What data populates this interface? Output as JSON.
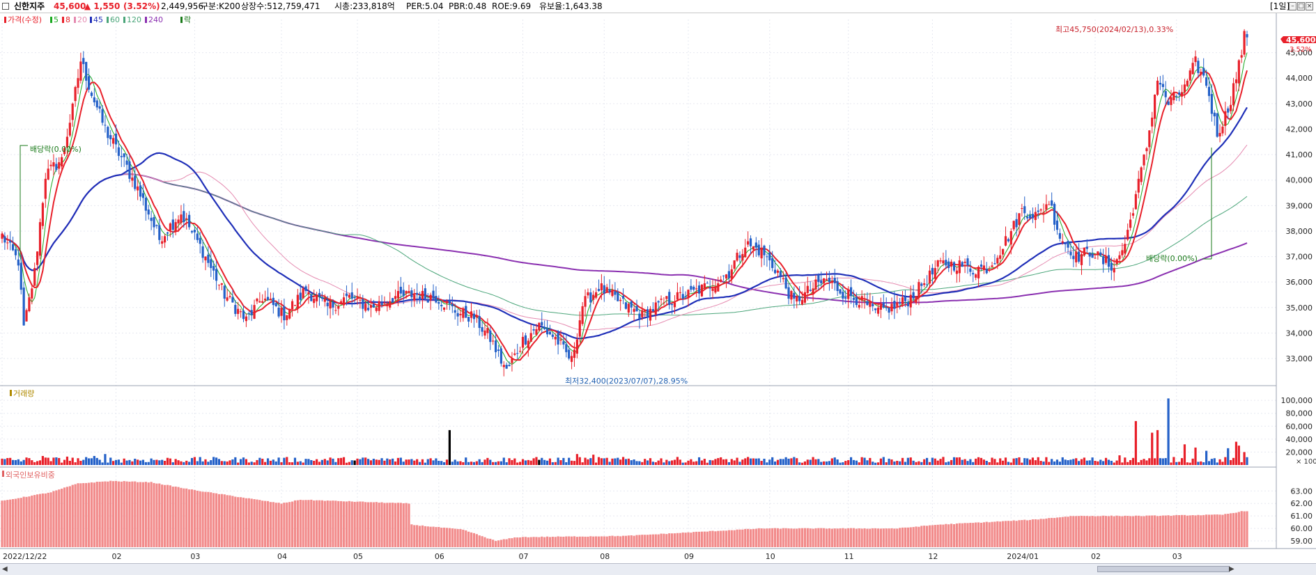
{
  "header": {
    "stock_name": "신한지주",
    "price": "45,600",
    "change": "▲ 1,550",
    "change_pct": "(3.52%)",
    "volume": "2,449,956",
    "market": "구분:K200",
    "shares": "상장수:512,759,471",
    "market_cap": "시총:233,818억",
    "per": "PER:5.04",
    "pbr": "PBR:0.48",
    "roe": "ROE:9.69",
    "float": "유보율:1,643.38",
    "period": "[1일]"
  },
  "colors": {
    "up": "#e8202a",
    "down": "#2360c8",
    "ma5": "#19a81f",
    "ma20": "#e8202a",
    "ma45": "#1f2fb8",
    "ma60": "#e58ab0",
    "ma120": "#4aa579",
    "ma240": "#8a2fb0",
    "ratio": "#f28b8b",
    "dividend": "#1a7a1a"
  },
  "legend": {
    "price": "가격(수정)",
    "ma5": "5",
    "ma8": "8",
    "ma20": "20",
    "ma45": "45",
    "ma60": "60",
    "ma120": "120",
    "ma240": "240",
    "dividend": "락"
  },
  "annotations": {
    "high": "최고45,750(2024/02/13),0.33%",
    "low": "최저32,400(2023/07/07),28.95%",
    "dividend_left": "배당락(0.00%)",
    "dividend_right": "배당락(0.00%)",
    "last_price": "45,600",
    "last_pct": "3.52%"
  },
  "chart_data": [
    {
      "type": "candlestick",
      "title": "",
      "x_labels": [
        "2022/12/22",
        "02",
        "03",
        "04",
        "05",
        "06",
        "07",
        "08",
        "09",
        "10",
        "11",
        "12",
        "2024/01",
        "02",
        "03"
      ],
      "y_ticks": [
        33000,
        34000,
        35000,
        36000,
        37000,
        38000,
        39000,
        40000,
        41000,
        42000,
        43000,
        44000,
        45000
      ],
      "y_tick_labels": [
        "33,000",
        "34,000",
        "35,000",
        "36,000",
        "37,000",
        "38,000",
        "39,000",
        "40,000",
        "41,000",
        "42,000",
        "43,000",
        "44,000",
        "45,000"
      ],
      "ylim": [
        32100,
        46300
      ],
      "close_anchors": [
        [
          0,
          37800
        ],
        [
          6,
          36800
        ],
        [
          8,
          34200
        ],
        [
          12,
          36400
        ],
        [
          16,
          40200
        ],
        [
          22,
          40800
        ],
        [
          26,
          42800
        ],
        [
          29,
          44700
        ],
        [
          33,
          43400
        ],
        [
          38,
          42000
        ],
        [
          45,
          40700
        ],
        [
          52,
          39200
        ],
        [
          58,
          37700
        ],
        [
          66,
          38700
        ],
        [
          74,
          37200
        ],
        [
          82,
          35500
        ],
        [
          90,
          34500
        ],
        [
          96,
          35400
        ],
        [
          104,
          34700
        ],
        [
          112,
          35700
        ],
        [
          120,
          35000
        ],
        [
          128,
          35400
        ],
        [
          136,
          35000
        ],
        [
          144,
          35400
        ],
        [
          152,
          35500
        ],
        [
          160,
          35400
        ],
        [
          168,
          34800
        ],
        [
          174,
          34600
        ],
        [
          180,
          33800
        ],
        [
          186,
          32500
        ],
        [
          192,
          33700
        ],
        [
          198,
          34300
        ],
        [
          204,
          33800
        ],
        [
          210,
          32900
        ],
        [
          214,
          35100
        ],
        [
          220,
          35800
        ],
        [
          228,
          35200
        ],
        [
          236,
          34700
        ],
        [
          244,
          35200
        ],
        [
          252,
          35500
        ],
        [
          260,
          35800
        ],
        [
          268,
          36400
        ],
        [
          274,
          37500
        ],
        [
          280,
          37200
        ],
        [
          286,
          36400
        ],
        [
          292,
          35200
        ],
        [
          298,
          35700
        ],
        [
          304,
          36100
        ],
        [
          310,
          35600
        ],
        [
          316,
          35300
        ],
        [
          322,
          34800
        ],
        [
          328,
          35000
        ],
        [
          334,
          35300
        ],
        [
          340,
          36000
        ],
        [
          346,
          36700
        ],
        [
          352,
          36700
        ],
        [
          358,
          36500
        ],
        [
          364,
          36600
        ],
        [
          370,
          37600
        ],
        [
          376,
          38800
        ],
        [
          382,
          38600
        ],
        [
          386,
          39200
        ],
        [
          390,
          37800
        ],
        [
          396,
          37000
        ],
        [
          402,
          37200
        ],
        [
          406,
          36800
        ],
        [
          410,
          36600
        ],
        [
          414,
          37500
        ],
        [
          418,
          39400
        ],
        [
          422,
          41300
        ],
        [
          426,
          44000
        ],
        [
          430,
          43000
        ],
        [
          436,
          43600
        ],
        [
          440,
          44600
        ],
        [
          444,
          43800
        ],
        [
          448,
          41800
        ],
        [
          452,
          42800
        ],
        [
          456,
          44500
        ],
        [
          458,
          45600
        ]
      ],
      "dividend_markers": [
        {
          "index": 8,
          "label": "배당락(0.00%)"
        },
        {
          "index": 442,
          "label": "배당락(0.00%)"
        }
      ],
      "high": {
        "value": 45750,
        "date": "2024/02/13"
      },
      "low": {
        "value": 32400,
        "date": "2023/07/07"
      },
      "last": 45600
    },
    {
      "type": "bar",
      "title": "거래량",
      "y_ticks": [
        20000,
        40000,
        60000,
        80000,
        100000
      ],
      "y_tick_labels": [
        "20,000",
        "40,000",
        "60,000",
        "80,000",
        "100,000"
      ],
      "unit": "× 100",
      "ylim": [
        0,
        112000
      ],
      "spikes": [
        [
          15,
          14000
        ],
        [
          24,
          13000
        ],
        [
          34,
          14000
        ],
        [
          38,
          17000
        ],
        [
          130,
          7000
        ],
        [
          165,
          54000
        ],
        [
          198,
          8000
        ],
        [
          212,
          17000
        ],
        [
          218,
          16000
        ],
        [
          407,
          11000
        ],
        [
          412,
          15000
        ],
        [
          418,
          68000
        ],
        [
          424,
          50000
        ],
        [
          426,
          54000
        ],
        [
          430,
          103000
        ],
        [
          436,
          32000
        ],
        [
          440,
          27000
        ],
        [
          444,
          22000
        ],
        [
          452,
          26000
        ],
        [
          455,
          36000
        ],
        [
          456,
          30000
        ],
        [
          458,
          20000
        ]
      ],
      "black_bars": [
        130,
        165,
        198
      ]
    },
    {
      "type": "bar",
      "title": "외국인보유비중",
      "y_ticks": [
        59,
        60,
        61,
        62,
        63
      ],
      "y_tick_labels": [
        "59.00",
        "60.00",
        "61.00",
        "62.00",
        "63.00"
      ],
      "ylim": [
        58.5,
        64.3
      ],
      "anchors": [
        [
          0,
          62.2
        ],
        [
          18,
          62.9
        ],
        [
          28,
          63.6
        ],
        [
          40,
          63.8
        ],
        [
          55,
          63.7
        ],
        [
          70,
          63.1
        ],
        [
          88,
          62.5
        ],
        [
          103,
          62.0
        ],
        [
          110,
          62.3
        ],
        [
          150,
          62.0
        ],
        [
          151,
          60.3
        ],
        [
          170,
          59.9
        ],
        [
          182,
          59.0
        ],
        [
          190,
          59.3
        ],
        [
          230,
          59.4
        ],
        [
          280,
          60.0
        ],
        [
          330,
          60.0
        ],
        [
          345,
          60.3
        ],
        [
          380,
          60.7
        ],
        [
          395,
          61.0
        ],
        [
          420,
          61.0
        ],
        [
          450,
          61.1
        ],
        [
          458,
          61.4
        ]
      ]
    }
  ]
}
